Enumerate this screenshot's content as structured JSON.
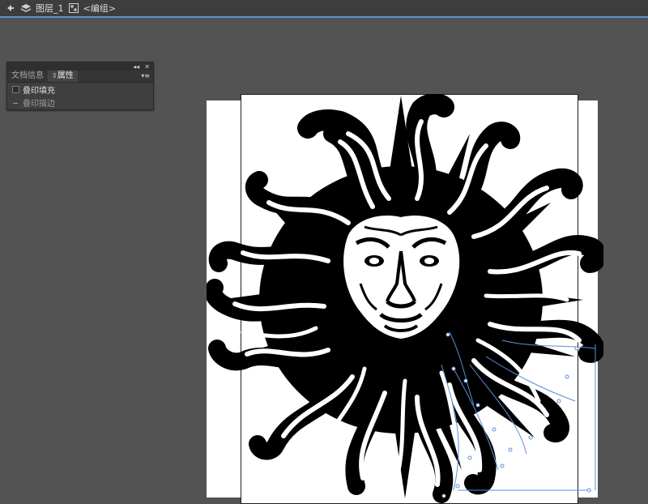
{
  "topbar": {
    "layer_label": "图层_1",
    "group_label": "<编组>"
  },
  "panel": {
    "tabs": [
      {
        "label": "文档信息",
        "active": false
      },
      {
        "label": "属性",
        "active": true
      }
    ],
    "options": [
      {
        "label": "叠印填充",
        "enabled": true
      },
      {
        "label": "叠印描边",
        "enabled": false
      }
    ]
  },
  "colors": {
    "background": "#535353",
    "artboard": "#ffffff",
    "selection": "#5b8fd6",
    "panel": "#3f3f3f",
    "artwork": "#000000"
  },
  "icons": [
    "back-arrow-icon",
    "layers-icon",
    "group-icon",
    "collapse-icon",
    "close-icon",
    "panel-menu-icon",
    "tab-arrows-icon"
  ]
}
